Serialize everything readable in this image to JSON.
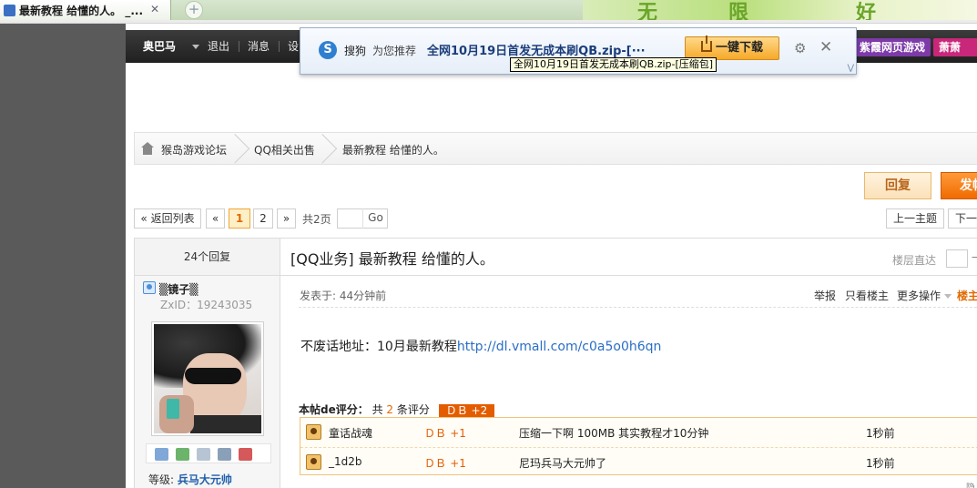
{
  "browser": {
    "tab_title": "最新教程  给懂的人。 _...",
    "tab_close": "✕",
    "new_tab": "+",
    "deco_glyphs": [
      "无",
      "限",
      "好"
    ]
  },
  "topnav": {
    "user": "奥巴马",
    "logout": "退出",
    "messages": "消息",
    "settings": "设",
    "game1": "紫霞网页游戏",
    "game2": "萧萧"
  },
  "popup": {
    "brand": "搜狗",
    "recommend": "为您推荐",
    "file": "全网10月19日首发无成本刷QB.zip-[···",
    "download": "一键下载",
    "tooltip": "全网10月19日首发无成本刷QB.zip-[压缩包]",
    "gear_icon": "⚙",
    "close_icon": "✕",
    "collapse_icon": "⋁"
  },
  "breadcrumb": {
    "forum": "猴岛游戏论坛",
    "section": "QQ相关出售",
    "thread": "最新教程  给懂的人。"
  },
  "actions": {
    "reply": "回复",
    "post": "发帖"
  },
  "pagination": {
    "back": "« 返回列表",
    "prev": "«",
    "page1": "1",
    "page2": "2",
    "next": "»",
    "total": "共2页",
    "go": "Go",
    "prev_topic": "上一主题",
    "next_topic": "下一主题"
  },
  "thread": {
    "reply_count": "24个回复",
    "title": "[QQ业务] 最新教程  给懂的人。",
    "floor_jump": "楼层直达",
    "floor_go": "→"
  },
  "author": {
    "name": "▒镜子▒",
    "zxid": "ZxID：19243035",
    "rank_label": "等级:",
    "rank_value": "兵马大元帅"
  },
  "post": {
    "time": "发表于: 44分钟前",
    "report": "举报",
    "only_author": "只看楼主",
    "more_ops": "更多操作",
    "floor": "楼主",
    "text_prefix": "不废话地址：10月最新教程",
    "link": "http://dl.vmall.com/c0a5o0h6qn",
    "rating_label": "本帖de评分：",
    "rating_total_pre": "共",
    "rating_count": "2",
    "rating_total_post": "条评分",
    "rating_sum": "ＤＢ +2",
    "ratings": [
      {
        "user": "童话战魂",
        "score_label": "ＤＢ",
        "score": "+1",
        "reason": "压缩一下啊 100MB 其实教程才10分钟",
        "time": "1秒前"
      },
      {
        "user": "_1d2b",
        "score_label": "ＤＢ",
        "score": "+1",
        "reason": "尼玛兵马大元帅了",
        "time": "1秒前"
      }
    ],
    "hide": "隐"
  }
}
